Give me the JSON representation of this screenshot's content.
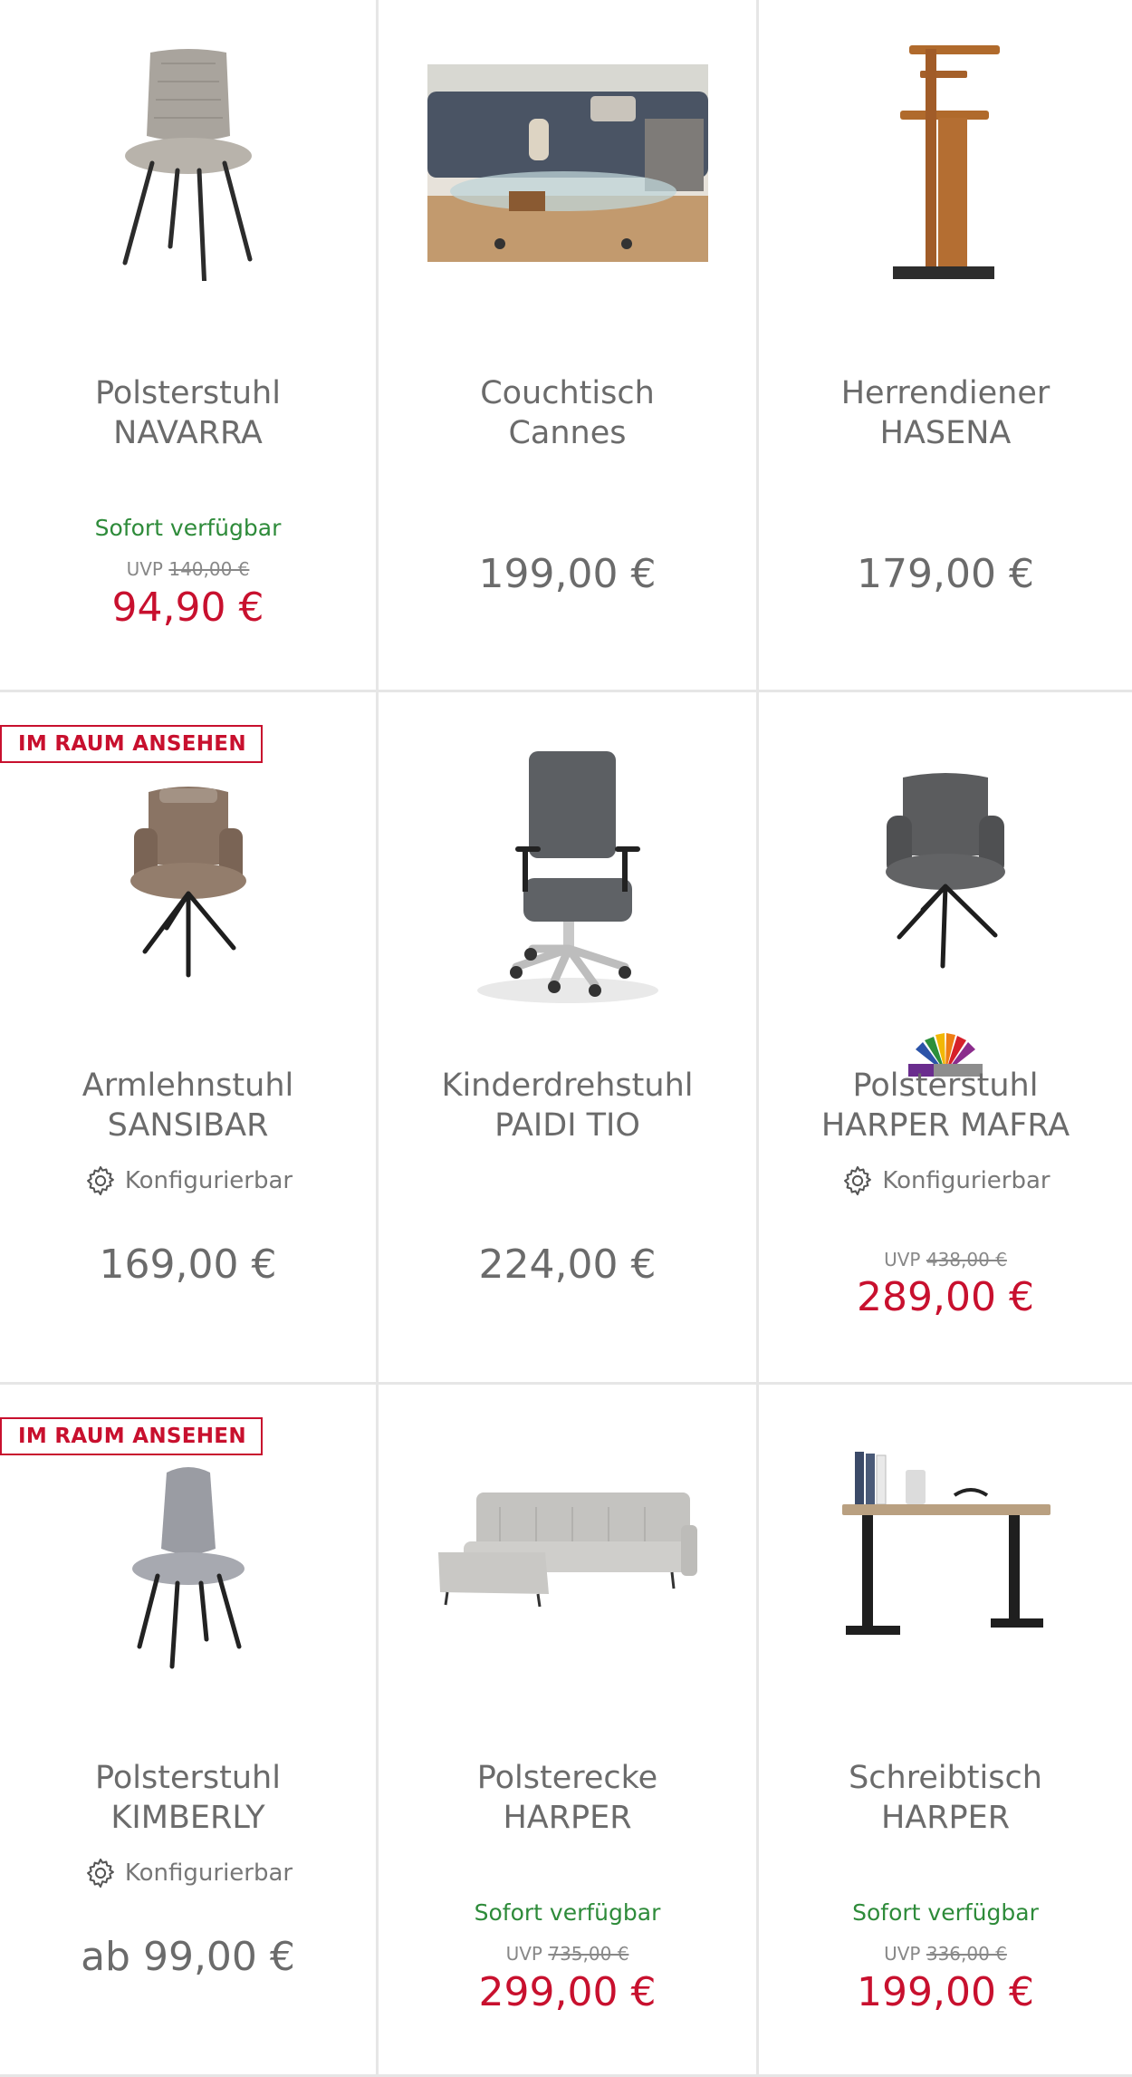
{
  "colors": {
    "sale": "#c8102e",
    "available": "#2e8b3a",
    "text": "#6b6b6b",
    "border": "#e6e6e6"
  },
  "products": [
    {
      "line1": "Polsterstuhl",
      "line2": "NAVARRA",
      "availability": "Sofort verfügbar",
      "uvp_label": "UVP",
      "uvp_price": "140,00 €",
      "price": "94,90 €",
      "image_icon": "chair-icon"
    },
    {
      "line1": "Couchtisch",
      "line2": "Cannes",
      "price": "199,00 €",
      "image_icon": "coffee-table-photo"
    },
    {
      "line1": "Herrendiener",
      "line2": "HASENA",
      "price": "179,00 €",
      "image_icon": "valet-stand-icon"
    },
    {
      "badge": "IM RAUM ANSEHEN",
      "line1": "Armlehnstuhl",
      "line2": "SANSIBAR",
      "config": "Konfigurierbar",
      "price": "169,00 €",
      "image_icon": "armchair-icon"
    },
    {
      "line1": "Kinderdrehstuhl",
      "line2": "PAIDI TIO",
      "price": "224,00 €",
      "image_icon": "office-chair-icon"
    },
    {
      "line1": "Polsterstuhl",
      "line2": "HARPER MAFRA",
      "config": "Konfigurierbar",
      "uvp_label": "UVP",
      "uvp_price": "438,00 €",
      "price": "289,00 €",
      "image_icon": "armchair-icon"
    },
    {
      "badge": "IM RAUM ANSEHEN",
      "line1": "Polsterstuhl",
      "line2": "KIMBERLY",
      "config": "Konfigurierbar",
      "price": "ab 99,00 €",
      "image_icon": "chair-icon"
    },
    {
      "line1": "Polsterecke",
      "line2": "HARPER",
      "availability": "Sofort verfügbar",
      "uvp_label": "UVP",
      "uvp_price": "735,00 €",
      "price": "299,00 €",
      "image_icon": "sofa-icon"
    },
    {
      "line1": "Schreibtisch",
      "line2": "HARPER",
      "availability": "Sofort verfügbar",
      "uvp_label": "UVP",
      "uvp_price": "336,00 €",
      "price": "199,00 €",
      "image_icon": "desk-icon"
    }
  ]
}
